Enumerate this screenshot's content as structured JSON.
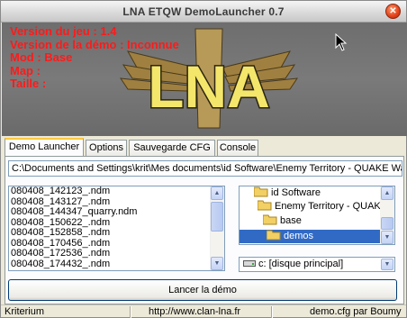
{
  "window": {
    "title": "LNA ETQW DemoLauncher 0.7"
  },
  "banner": {
    "logo_text": "LNA",
    "info": [
      "Version du jeu :  1.4",
      "Version de la démo : Inconnue",
      "Mod : Base",
      "Map :",
      "Taille :"
    ]
  },
  "tabs": [
    "Demo Launcher",
    "Options",
    "Sauvegarde CFG",
    "Console"
  ],
  "path": "C:\\Documents and Settings\\krit\\Mes documents\\id Software\\Enemy Territory - QUAKE Wars",
  "files": [
    "080408_142123_.ndm",
    "080408_143127_.ndm",
    "080408_144347_quarry.ndm",
    "080408_150622_.ndm",
    "080408_152858_.ndm",
    "080408_170456_.ndm",
    "080408_172536_.ndm",
    "080408_174432_.ndm"
  ],
  "dirs": [
    "id Software",
    "Enemy Territory - QUAKE Wars",
    "base",
    "demos"
  ],
  "drive": "c: [disque principal]",
  "launch_button": "Lancer la démo",
  "status": {
    "left": "Kriterium",
    "center": "http://www.clan-lna.fr",
    "right": "demo.cfg par Boumy"
  },
  "colors": {
    "info_text": "#ff1a1a",
    "selection": "#316ac5",
    "tab_highlight": "#ffc73c"
  }
}
